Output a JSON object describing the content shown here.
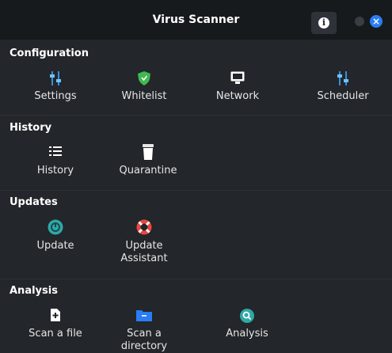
{
  "titlebar": {
    "title": "Virus Scanner",
    "info_icon": "info-icon",
    "close_icon": "close-icon"
  },
  "sections": {
    "configuration": {
      "title": "Configuration",
      "items": [
        {
          "label": "Settings",
          "icon": "sliders-icon"
        },
        {
          "label": "Whitelist",
          "icon": "shield-icon"
        },
        {
          "label": "Network",
          "icon": "monitor-icon"
        },
        {
          "label": "Scheduler",
          "icon": "sliders-icon"
        }
      ]
    },
    "history": {
      "title": "History",
      "items": [
        {
          "label": "History",
          "icon": "list-icon"
        },
        {
          "label": "Quarantine",
          "icon": "trash-icon"
        }
      ]
    },
    "updates": {
      "title": "Updates",
      "items": [
        {
          "label": "Update",
          "icon": "update-icon"
        },
        {
          "label": "Update Assistant",
          "icon": "lifebuoy-icon"
        }
      ]
    },
    "analysis": {
      "title": "Analysis",
      "items": [
        {
          "label": "Scan a file",
          "icon": "file-icon"
        },
        {
          "label": "Scan a directory",
          "icon": "folder-icon"
        },
        {
          "label": "Analysis",
          "icon": "search-icon"
        }
      ]
    }
  },
  "colors": {
    "accent_blue": "#2a7df4",
    "teal": "#2fa8a8",
    "shield_green": "#3fb950",
    "lifebuoy_red": "#e8483c",
    "background": "#23262a",
    "titlebar": "#171a1d"
  }
}
